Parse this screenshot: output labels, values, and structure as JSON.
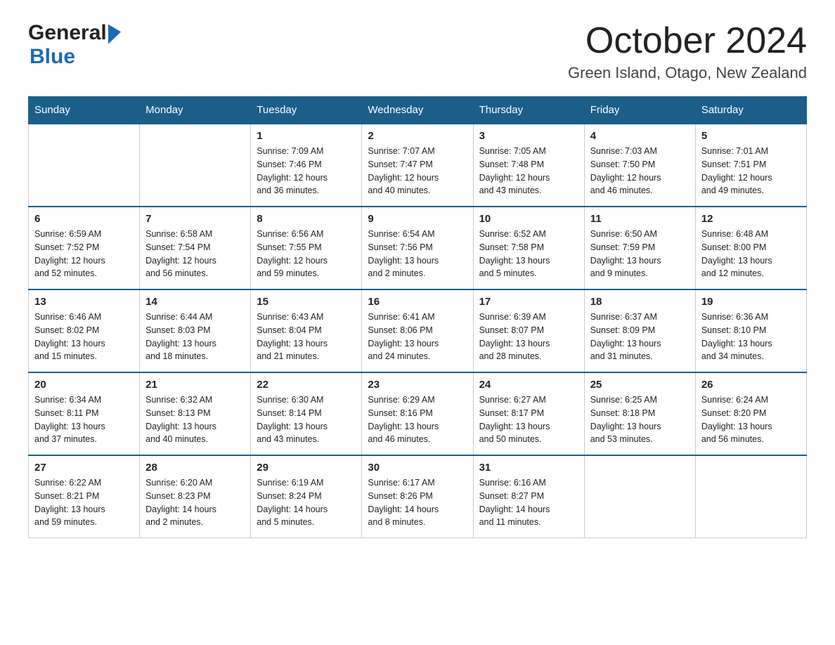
{
  "header": {
    "logo_general": "General",
    "logo_blue": "Blue",
    "month": "October 2024",
    "location": "Green Island, Otago, New Zealand"
  },
  "weekdays": [
    "Sunday",
    "Monday",
    "Tuesday",
    "Wednesday",
    "Thursday",
    "Friday",
    "Saturday"
  ],
  "weeks": [
    [
      {
        "day": "",
        "info": ""
      },
      {
        "day": "",
        "info": ""
      },
      {
        "day": "1",
        "info": "Sunrise: 7:09 AM\nSunset: 7:46 PM\nDaylight: 12 hours\nand 36 minutes."
      },
      {
        "day": "2",
        "info": "Sunrise: 7:07 AM\nSunset: 7:47 PM\nDaylight: 12 hours\nand 40 minutes."
      },
      {
        "day": "3",
        "info": "Sunrise: 7:05 AM\nSunset: 7:48 PM\nDaylight: 12 hours\nand 43 minutes."
      },
      {
        "day": "4",
        "info": "Sunrise: 7:03 AM\nSunset: 7:50 PM\nDaylight: 12 hours\nand 46 minutes."
      },
      {
        "day": "5",
        "info": "Sunrise: 7:01 AM\nSunset: 7:51 PM\nDaylight: 12 hours\nand 49 minutes."
      }
    ],
    [
      {
        "day": "6",
        "info": "Sunrise: 6:59 AM\nSunset: 7:52 PM\nDaylight: 12 hours\nand 52 minutes."
      },
      {
        "day": "7",
        "info": "Sunrise: 6:58 AM\nSunset: 7:54 PM\nDaylight: 12 hours\nand 56 minutes."
      },
      {
        "day": "8",
        "info": "Sunrise: 6:56 AM\nSunset: 7:55 PM\nDaylight: 12 hours\nand 59 minutes."
      },
      {
        "day": "9",
        "info": "Sunrise: 6:54 AM\nSunset: 7:56 PM\nDaylight: 13 hours\nand 2 minutes."
      },
      {
        "day": "10",
        "info": "Sunrise: 6:52 AM\nSunset: 7:58 PM\nDaylight: 13 hours\nand 5 minutes."
      },
      {
        "day": "11",
        "info": "Sunrise: 6:50 AM\nSunset: 7:59 PM\nDaylight: 13 hours\nand 9 minutes."
      },
      {
        "day": "12",
        "info": "Sunrise: 6:48 AM\nSunset: 8:00 PM\nDaylight: 13 hours\nand 12 minutes."
      }
    ],
    [
      {
        "day": "13",
        "info": "Sunrise: 6:46 AM\nSunset: 8:02 PM\nDaylight: 13 hours\nand 15 minutes."
      },
      {
        "day": "14",
        "info": "Sunrise: 6:44 AM\nSunset: 8:03 PM\nDaylight: 13 hours\nand 18 minutes."
      },
      {
        "day": "15",
        "info": "Sunrise: 6:43 AM\nSunset: 8:04 PM\nDaylight: 13 hours\nand 21 minutes."
      },
      {
        "day": "16",
        "info": "Sunrise: 6:41 AM\nSunset: 8:06 PM\nDaylight: 13 hours\nand 24 minutes."
      },
      {
        "day": "17",
        "info": "Sunrise: 6:39 AM\nSunset: 8:07 PM\nDaylight: 13 hours\nand 28 minutes."
      },
      {
        "day": "18",
        "info": "Sunrise: 6:37 AM\nSunset: 8:09 PM\nDaylight: 13 hours\nand 31 minutes."
      },
      {
        "day": "19",
        "info": "Sunrise: 6:36 AM\nSunset: 8:10 PM\nDaylight: 13 hours\nand 34 minutes."
      }
    ],
    [
      {
        "day": "20",
        "info": "Sunrise: 6:34 AM\nSunset: 8:11 PM\nDaylight: 13 hours\nand 37 minutes."
      },
      {
        "day": "21",
        "info": "Sunrise: 6:32 AM\nSunset: 8:13 PM\nDaylight: 13 hours\nand 40 minutes."
      },
      {
        "day": "22",
        "info": "Sunrise: 6:30 AM\nSunset: 8:14 PM\nDaylight: 13 hours\nand 43 minutes."
      },
      {
        "day": "23",
        "info": "Sunrise: 6:29 AM\nSunset: 8:16 PM\nDaylight: 13 hours\nand 46 minutes."
      },
      {
        "day": "24",
        "info": "Sunrise: 6:27 AM\nSunset: 8:17 PM\nDaylight: 13 hours\nand 50 minutes."
      },
      {
        "day": "25",
        "info": "Sunrise: 6:25 AM\nSunset: 8:18 PM\nDaylight: 13 hours\nand 53 minutes."
      },
      {
        "day": "26",
        "info": "Sunrise: 6:24 AM\nSunset: 8:20 PM\nDaylight: 13 hours\nand 56 minutes."
      }
    ],
    [
      {
        "day": "27",
        "info": "Sunrise: 6:22 AM\nSunset: 8:21 PM\nDaylight: 13 hours\nand 59 minutes."
      },
      {
        "day": "28",
        "info": "Sunrise: 6:20 AM\nSunset: 8:23 PM\nDaylight: 14 hours\nand 2 minutes."
      },
      {
        "day": "29",
        "info": "Sunrise: 6:19 AM\nSunset: 8:24 PM\nDaylight: 14 hours\nand 5 minutes."
      },
      {
        "day": "30",
        "info": "Sunrise: 6:17 AM\nSunset: 8:26 PM\nDaylight: 14 hours\nand 8 minutes."
      },
      {
        "day": "31",
        "info": "Sunrise: 6:16 AM\nSunset: 8:27 PM\nDaylight: 14 hours\nand 11 minutes."
      },
      {
        "day": "",
        "info": ""
      },
      {
        "day": "",
        "info": ""
      }
    ]
  ]
}
